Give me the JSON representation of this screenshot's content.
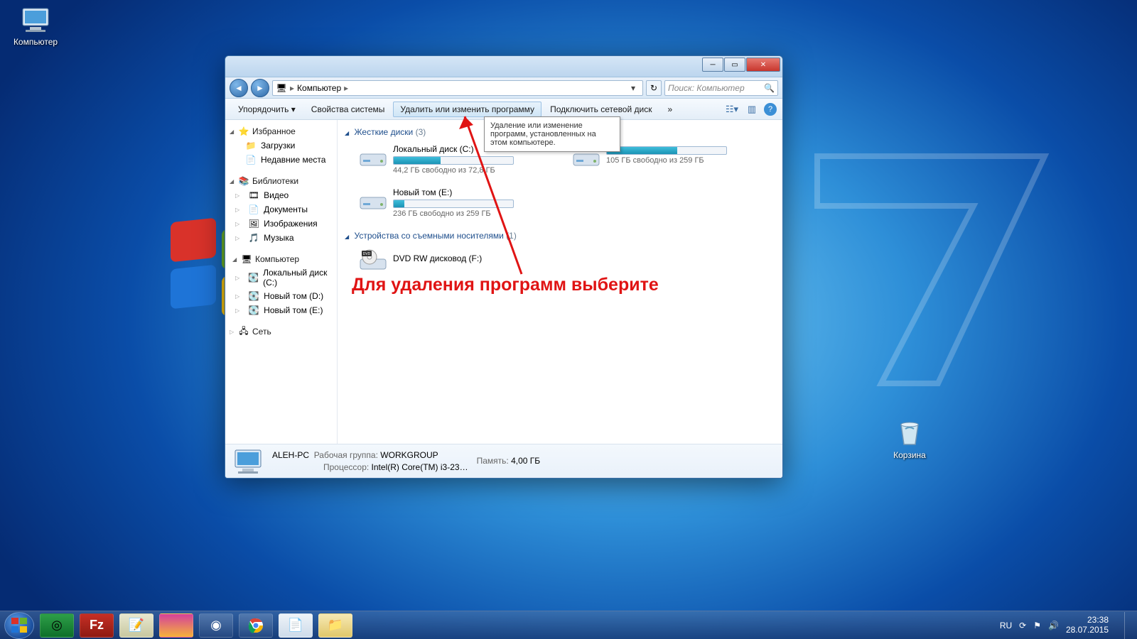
{
  "desktop": {
    "computer": "Компьютер",
    "recycle": "Корзина"
  },
  "window": {
    "breadcrumb_item": "Компьютер",
    "search_placeholder": "Поиск: Компьютер",
    "toolbar": {
      "organize": "Упорядочить",
      "system_props": "Свойства системы",
      "uninstall": "Удалить или изменить программу",
      "map_drive": "Подключить сетевой диск",
      "overflow": "»"
    },
    "tooltip": "Удаление или изменение программ, установленных на этом компьютере.",
    "sidebar": {
      "favorites": "Избранное",
      "downloads": "Загрузки",
      "recent": "Недавние места",
      "libraries": "Библиотеки",
      "video": "Видео",
      "documents": "Документы",
      "pictures": "Изображения",
      "music": "Музыка",
      "computer": "Компьютер",
      "drive_c": "Локальный диск (C:)",
      "drive_d": "Новый том (D:)",
      "drive_e": "Новый том (E:)",
      "network": "Сеть"
    },
    "content": {
      "hdd_header": "Жесткие диски",
      "hdd_count": "(3)",
      "removable_header": "Устройства со съемными носителями",
      "removable_count": "(1)",
      "drive_c": {
        "name": "Локальный диск (C:)",
        "sub": "44,2 ГБ свободно из 72,8 ГБ",
        "fill": 39
      },
      "drive_d": {
        "name": "",
        "sub": "105 ГБ свободно из 259 ГБ",
        "fill": 59
      },
      "drive_e": {
        "name": "Новый том (E:)",
        "sub": "236 ГБ свободно из 259 ГБ",
        "fill": 9
      },
      "dvd": {
        "name": "DVD RW дисковод (F:)"
      }
    },
    "details": {
      "name": "ALEH-PC",
      "workgroup_label": "Рабочая группа:",
      "workgroup": "WORKGROUP",
      "memory_label": "Память:",
      "memory": "4,00 ГБ",
      "cpu_label": "Процессор:",
      "cpu": "Intel(R) Core(TM) i3-23…"
    }
  },
  "annotation": "Для удаления программ выберите",
  "taskbar": {
    "lang": "RU",
    "time": "23:38",
    "date": "28.07.2015"
  }
}
